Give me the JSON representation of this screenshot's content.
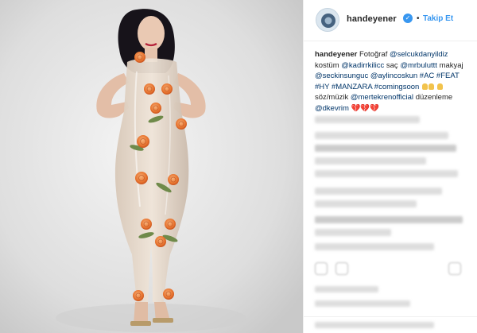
{
  "post": {
    "username": "handeyener",
    "verified_icon": "verified-badge-icon",
    "separator": "•",
    "follow_label": "Takip Et"
  },
  "caption": {
    "author": "handeyener",
    "t1": "Fotoğraf",
    "m_photo": "@selcukdanyildiz",
    "t2": "kostüm",
    "m_costume": "@kadirrkilicc",
    "t3": "saç",
    "m_hair": "@mrbuluttt",
    "t4": "makyaj",
    "m_makeup1": "@seckinsunguc",
    "m_makeup2": "@aylincoskun",
    "tags": "#AC #FEAT #HY #MANZARA #comingsoon",
    "t5": "söz/müzik",
    "m_music": "@mertekrenofficial",
    "t6": "düzenleme",
    "m_edit": "@dkevrim",
    "hearts": "💔💔💔",
    "praise_icon": "praise-hands-icon"
  },
  "colors": {
    "accent": "#3897f0",
    "text": "#262626",
    "mention": "#003569",
    "border": "#efefef"
  }
}
